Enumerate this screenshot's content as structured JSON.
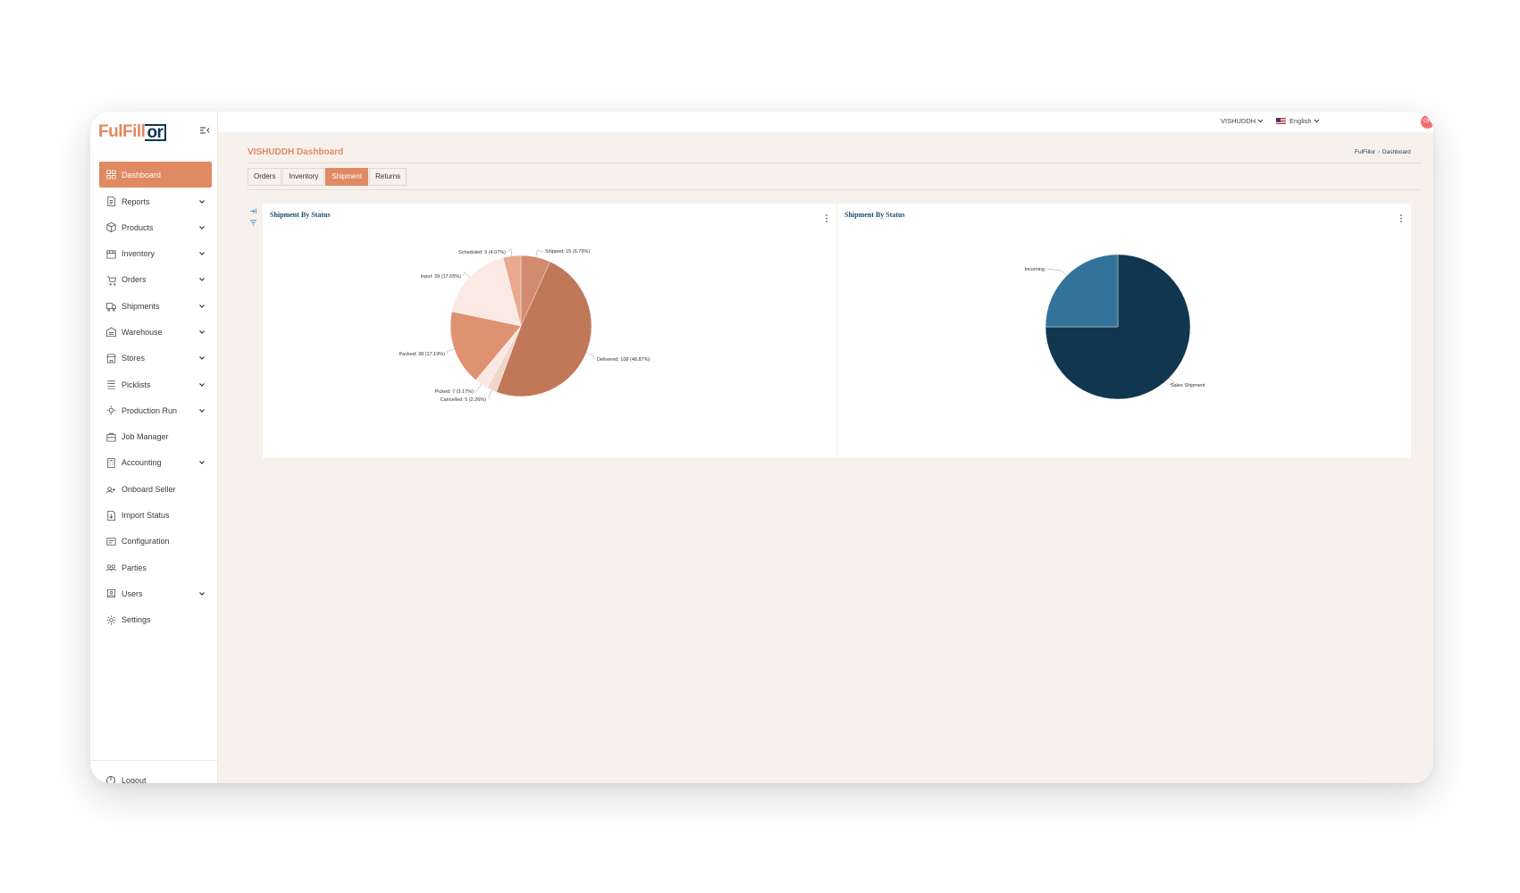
{
  "app": {
    "logo_part1": "FulFill",
    "logo_part2": "or"
  },
  "sidebar": {
    "items": [
      {
        "label": "Dashboard",
        "icon": "dashboard-icon",
        "active": true,
        "has_chevron": false
      },
      {
        "label": "Reports",
        "icon": "reports-icon",
        "has_chevron": true
      },
      {
        "label": "Products",
        "icon": "products-icon",
        "has_chevron": true
      },
      {
        "label": "Inventory",
        "icon": "inventory-icon",
        "has_chevron": true
      },
      {
        "label": "Orders",
        "icon": "orders-icon",
        "has_chevron": true
      },
      {
        "label": "Shipments",
        "icon": "shipments-icon",
        "has_chevron": true
      },
      {
        "label": "Warehouse",
        "icon": "warehouse-icon",
        "has_chevron": true
      },
      {
        "label": "Stores",
        "icon": "stores-icon",
        "has_chevron": true
      },
      {
        "label": "Picklists",
        "icon": "picklists-icon",
        "has_chevron": true
      },
      {
        "label": "Production Run",
        "icon": "production-run-icon",
        "has_chevron": true
      },
      {
        "label": "Job Manager",
        "icon": "job-manager-icon",
        "has_chevron": false
      },
      {
        "label": "Accounting",
        "icon": "accounting-icon",
        "has_chevron": true
      },
      {
        "label": "Onboard Seller",
        "icon": "onboard-seller-icon",
        "has_chevron": false
      },
      {
        "label": "Import Status",
        "icon": "import-status-icon",
        "has_chevron": false
      },
      {
        "label": "Configuration",
        "icon": "configuration-icon",
        "has_chevron": false
      },
      {
        "label": "Parties",
        "icon": "parties-icon",
        "has_chevron": false
      },
      {
        "label": "Users",
        "icon": "users-icon",
        "has_chevron": true
      },
      {
        "label": "Settings",
        "icon": "settings-icon",
        "has_chevron": false
      }
    ],
    "logout_label": "Logout"
  },
  "topbar": {
    "account_label": "VISHUDDH",
    "language_label": "English",
    "avatar_initials": "OR"
  },
  "page": {
    "title": "VISHUDDH Dashboard",
    "breadcrumb": [
      "FulFillor",
      "Dashboard"
    ],
    "tabs": [
      {
        "label": "Orders",
        "active": false
      },
      {
        "label": "Inventory",
        "active": false
      },
      {
        "label": "Shipment",
        "active": true
      },
      {
        "label": "Returns",
        "active": false
      }
    ]
  },
  "colors": {
    "accent": "#df8a63",
    "navy": "#10374f",
    "steel": "#33739a",
    "background": "#f6f1ec"
  },
  "chart_data": [
    {
      "type": "pie",
      "title": "Shipment By Status",
      "slices": [
        {
          "label": "Shipped",
          "value": 15,
          "pct": "6.79%",
          "display": "Shipped: 15 (6.79%)",
          "color": "#d28b6e"
        },
        {
          "label": "Delivered",
          "value": 108,
          "pct": "48.87%",
          "display": "Delivered: 108 (48.87%)",
          "color": "#c07859"
        },
        {
          "label": "Cancelled",
          "value": 5,
          "pct": "2.26%",
          "display": "Cancelled: 5 (2.26%)",
          "color": "#f1d6ca"
        },
        {
          "label": "Picked",
          "value": 7,
          "pct": "3.17%",
          "display": "Picked: 7 (3.17%)",
          "color": "#f9e9e2"
        },
        {
          "label": "Packed",
          "value": 38,
          "pct": "17.19%",
          "display": "Packed: 38 (17.19%)",
          "color": "#df9272"
        },
        {
          "label": "Input",
          "value": 39,
          "pct": "17.65%",
          "display": "Input: 39 (17.65%)",
          "color": "#fbe9e4"
        },
        {
          "label": "Scheduled",
          "value": 9,
          "pct": "4.07%",
          "display": "Scheduled: 9 (4.07%)",
          "color": "#e9a98d"
        }
      ]
    },
    {
      "type": "pie",
      "title": "Shipment By Status",
      "slices": [
        {
          "label": "Sales Shipment",
          "value": 75,
          "display": "Sales Shipment",
          "color": "#10374f"
        },
        {
          "label": "Incoming",
          "value": 25,
          "display": "Incoming",
          "color": "#33739a"
        }
      ]
    }
  ]
}
